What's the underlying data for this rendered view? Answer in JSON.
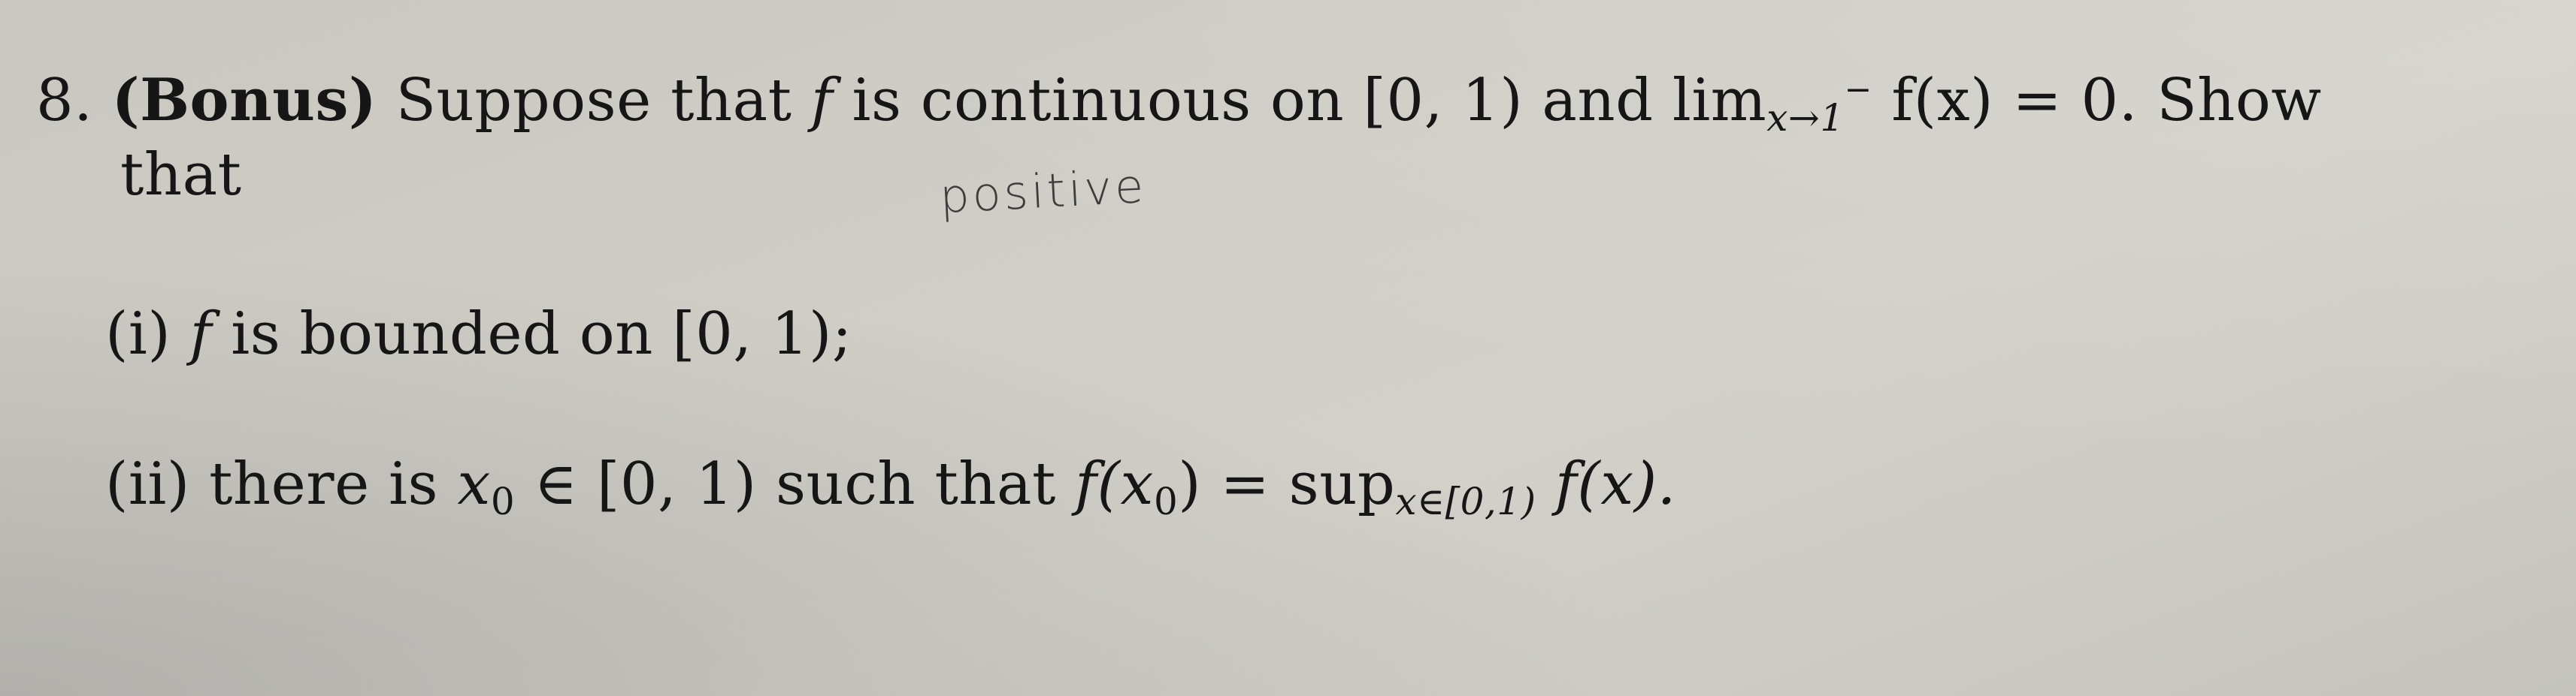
{
  "problem": {
    "number": "8.",
    "tag": "(Bonus)",
    "intro_a": "Suppose that",
    "f": "f",
    "intro_b": "is continuous on [0, 1) and lim",
    "lim_sub": "x→1",
    "lim_sup": "−",
    "intro_c": "f(x) = 0.  Show",
    "intro_d": "that",
    "parts": [
      {
        "label": "(i)",
        "f": "f",
        "text": "is bounded on [0, 1);"
      },
      {
        "label": "(ii)",
        "text_a": "there is",
        "x0": "x",
        "x0_sub": "0",
        "text_b": "∈ [0, 1) such that",
        "fx0_a": "f(x",
        "fx0_sub": "0",
        "fx0_b": ")",
        "eq": "= sup",
        "sup_sub": "x∈[0,1)",
        "tail": "f(x)."
      }
    ]
  },
  "annotation": {
    "handwritten": "positive"
  }
}
